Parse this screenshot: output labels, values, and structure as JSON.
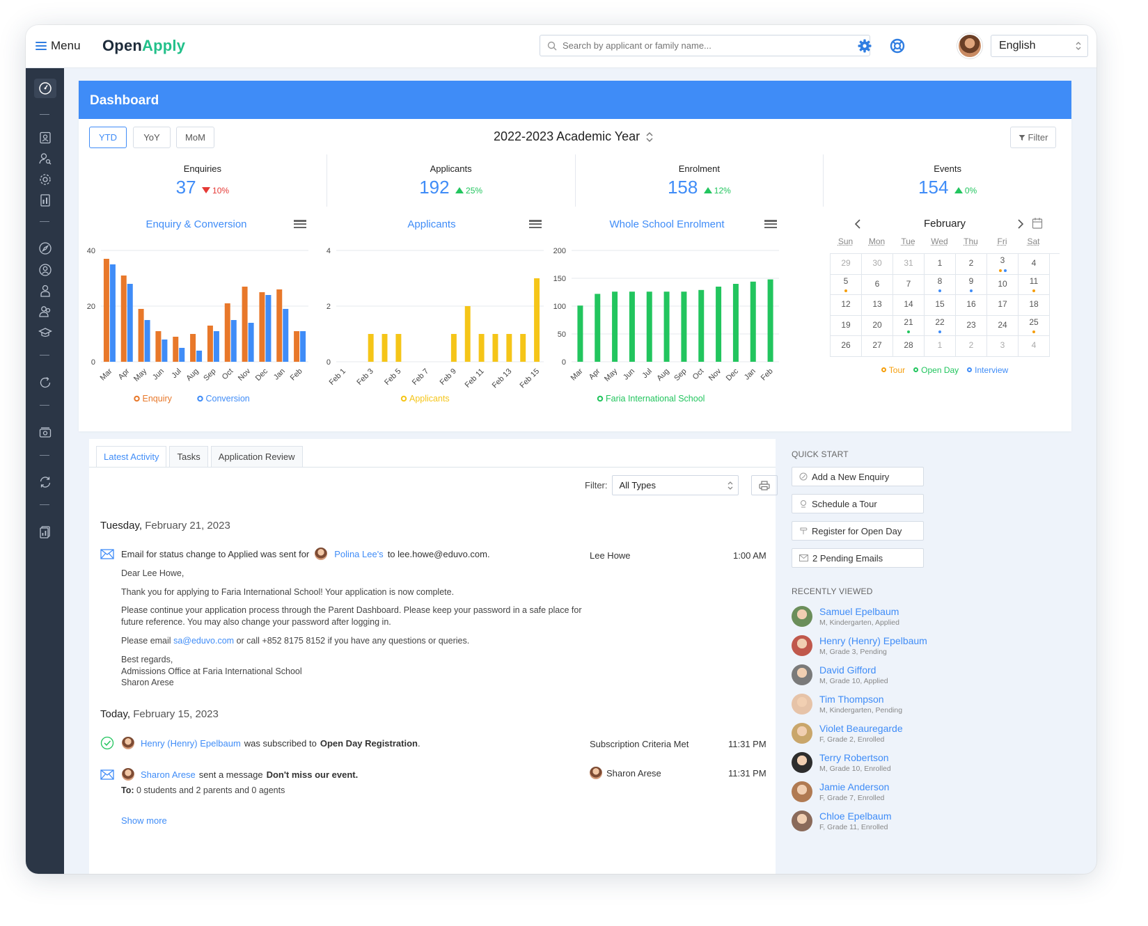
{
  "topbar": {
    "menu_label": "Menu",
    "logo_part1": "Open",
    "logo_part2": "Apply",
    "search_placeholder": "Search by applicant or family name...",
    "language": "English"
  },
  "dashboard": {
    "title": "Dashboard",
    "periods": [
      "YTD",
      "YoY",
      "MoM"
    ],
    "active_period": "YTD",
    "academic_year": "2022-2023 Academic Year",
    "filter_label": "Filter"
  },
  "stats": [
    {
      "label": "Enquiries",
      "value": "37",
      "change": "10%",
      "direction": "down"
    },
    {
      "label": "Applicants",
      "value": "192",
      "change": "25%",
      "direction": "up"
    },
    {
      "label": "Enrolment",
      "value": "158",
      "change": "12%",
      "direction": "up"
    },
    {
      "label": "Events",
      "value": "154",
      "change": "0%",
      "direction": "up"
    }
  ],
  "chart_data": [
    {
      "type": "bar",
      "title": "Enquiry & Conversion",
      "categories": [
        "Mar",
        "Apr",
        "May",
        "Jun",
        "Jul",
        "Aug",
        "Sep",
        "Oct",
        "Nov",
        "Dec",
        "Jan",
        "Feb"
      ],
      "series": [
        {
          "name": "Enquiry",
          "color": "#e8782a",
          "values": [
            37,
            31,
            19,
            11,
            9,
            10,
            13,
            21,
            27,
            25,
            26,
            11
          ]
        },
        {
          "name": "Conversion",
          "color": "#3f8cf7",
          "values": [
            35,
            28,
            15,
            8,
            5,
            4,
            11,
            15,
            14,
            24,
            19,
            11
          ]
        }
      ],
      "yticks": [
        "0",
        "20",
        "40"
      ],
      "ylim": [
        0,
        40
      ],
      "grid": true,
      "legend": "bottom"
    },
    {
      "type": "bar",
      "title": "Applicants",
      "categories": [
        "Feb 1",
        "Feb 2",
        "Feb 3",
        "Feb 4",
        "Feb 5",
        "Feb 6",
        "Feb 7",
        "Feb 8",
        "Feb 9",
        "Feb 10",
        "Feb 11",
        "Feb 12",
        "Feb 13",
        "Feb 14",
        "Feb 15"
      ],
      "tick_labels": [
        "Feb 1",
        "Feb 3",
        "Feb 5",
        "Feb 7",
        "Feb 9",
        "Feb 11",
        "Feb 13",
        "Feb 15"
      ],
      "series": [
        {
          "name": "Applicants",
          "color": "#f5c518",
          "values": [
            0,
            0,
            1,
            1,
            1,
            0,
            0,
            0,
            1,
            2,
            1,
            1,
            1,
            1,
            3
          ]
        }
      ],
      "yticks": [
        "0",
        "2",
        "4"
      ],
      "ylim": [
        0,
        4
      ],
      "grid": true,
      "legend": "bottom"
    },
    {
      "type": "bar",
      "title": "Whole School Enrolment",
      "categories": [
        "Mar",
        "Apr",
        "May",
        "Jun",
        "Jul",
        "Aug",
        "Sep",
        "Oct",
        "Nov",
        "Dec",
        "Jan",
        "Feb"
      ],
      "series": [
        {
          "name": "Faria International School",
          "color": "#22c55e",
          "values": [
            101,
            122,
            126,
            126,
            126,
            126,
            126,
            129,
            135,
            140,
            144,
            148
          ]
        }
      ],
      "yticks": [
        "0",
        "50",
        "100",
        "150",
        "200"
      ],
      "ylim": [
        0,
        200
      ],
      "grid": true,
      "legend": "bottom"
    }
  ],
  "calendar": {
    "month": "February",
    "days_of_week": [
      "Sun",
      "Mon",
      "Tue",
      "Wed",
      "Thu",
      "Fri",
      "Sat"
    ],
    "weeks": [
      [
        {
          "d": "29",
          "dim": true
        },
        {
          "d": "30",
          "dim": true
        },
        {
          "d": "31",
          "dim": true
        },
        {
          "d": "1"
        },
        {
          "d": "2"
        },
        {
          "d": "3",
          "dots": [
            "tour",
            "interview"
          ]
        },
        {
          "d": "4"
        }
      ],
      [
        {
          "d": "5",
          "dots": [
            "tour"
          ]
        },
        {
          "d": "6"
        },
        {
          "d": "7"
        },
        {
          "d": "8",
          "dots": [
            "interview"
          ]
        },
        {
          "d": "9",
          "dots": [
            "interview"
          ]
        },
        {
          "d": "10"
        },
        {
          "d": "11",
          "dots": [
            "tour"
          ]
        }
      ],
      [
        {
          "d": "12"
        },
        {
          "d": "13"
        },
        {
          "d": "14"
        },
        {
          "d": "15"
        },
        {
          "d": "16"
        },
        {
          "d": "17"
        },
        {
          "d": "18"
        }
      ],
      [
        {
          "d": "19"
        },
        {
          "d": "20"
        },
        {
          "d": "21",
          "dots": [
            "open"
          ]
        },
        {
          "d": "22",
          "dots": [
            "interview"
          ]
        },
        {
          "d": "23"
        },
        {
          "d": "24"
        },
        {
          "d": "25",
          "dots": [
            "tour"
          ]
        }
      ],
      [
        {
          "d": "26"
        },
        {
          "d": "27"
        },
        {
          "d": "28"
        },
        {
          "d": "1",
          "dim": true
        },
        {
          "d": "2",
          "dim": true
        },
        {
          "d": "3",
          "dim": true
        },
        {
          "d": "4",
          "dim": true
        }
      ]
    ],
    "legend": [
      {
        "label": "Tour",
        "color": "#f59e0b"
      },
      {
        "label": "Open Day",
        "color": "#22c55e"
      },
      {
        "label": "Interview",
        "color": "#3f8cf7"
      }
    ]
  },
  "activity": {
    "tabs": [
      "Latest Activity",
      "Tasks",
      "Application Review"
    ],
    "filter_label": "Filter:",
    "filter_value": "All Types",
    "day1_weekday": "Tuesday,",
    "day1_date": "February 21, 2023",
    "item1_pre": "Email for status change to Applied was sent for",
    "item1_person": "Polina Lee's",
    "item1_post": "to lee.howe@eduvo.com.",
    "item1_owner": "Lee Howe",
    "item1_time": "1:00 AM",
    "email_greeting": "Dear Lee Howe,",
    "email_p1": "Thank you for applying to Faria International School! Your application is now complete.",
    "email_p2": "Please continue your application process through the Parent Dashboard. Please keep your password in a safe place for future reference. You may also change your password after logging in.",
    "email_p3_pre": "Please email",
    "email_p3_link": "sa@eduvo.com",
    "email_p3_post": "or call +852 8175 8152 if you have any questions or queries.",
    "email_sign1": "Best regards,",
    "email_sign2": "Admissions Office at Faria International School",
    "email_sign3": "Sharon Arese",
    "day2_weekday": "Today,",
    "day2_date": "February 15, 2023",
    "item2_person": "Henry (Henry) Epelbaum",
    "item2_mid": "was subscribed to",
    "item2_bold": "Open Day Registration",
    "item2_end": ".",
    "item2_owner": "Subscription Criteria Met",
    "item2_time": "11:31 PM",
    "item3_person": "Sharon Arese",
    "item3_mid": "sent a message",
    "item3_bold": "Don't miss our event.",
    "item3_to_label": "To:",
    "item3_to": "0 students and 2 parents and 0 agents",
    "item3_owner": "Sharon Arese",
    "item3_time": "11:31 PM",
    "show_more": "Show more"
  },
  "quick_start": {
    "title": "QUICK START",
    "buttons": [
      "Add a New Enquiry",
      "Schedule a Tour",
      "Register for Open Day",
      "2 Pending Emails"
    ]
  },
  "recently_viewed": {
    "title": "RECENTLY VIEWED",
    "people": [
      {
        "name": "Samuel Epelbaum",
        "sub": "M, Kindergarten, Applied"
      },
      {
        "name": "Henry (Henry) Epelbaum",
        "sub": "M, Grade 3, Pending"
      },
      {
        "name": "David Gifford",
        "sub": "M, Grade 10, Applied"
      },
      {
        "name": "Tim Thompson",
        "sub": "M, Kindergarten, Pending"
      },
      {
        "name": "Violet Beauregarde",
        "sub": "F, Grade 2, Enrolled"
      },
      {
        "name": "Terry Robertson",
        "sub": "M, Grade 10, Enrolled"
      },
      {
        "name": "Jamie Anderson",
        "sub": "F, Grade 7, Enrolled"
      },
      {
        "name": "Chloe Epelbaum",
        "sub": "F, Grade 11, Enrolled"
      }
    ]
  }
}
